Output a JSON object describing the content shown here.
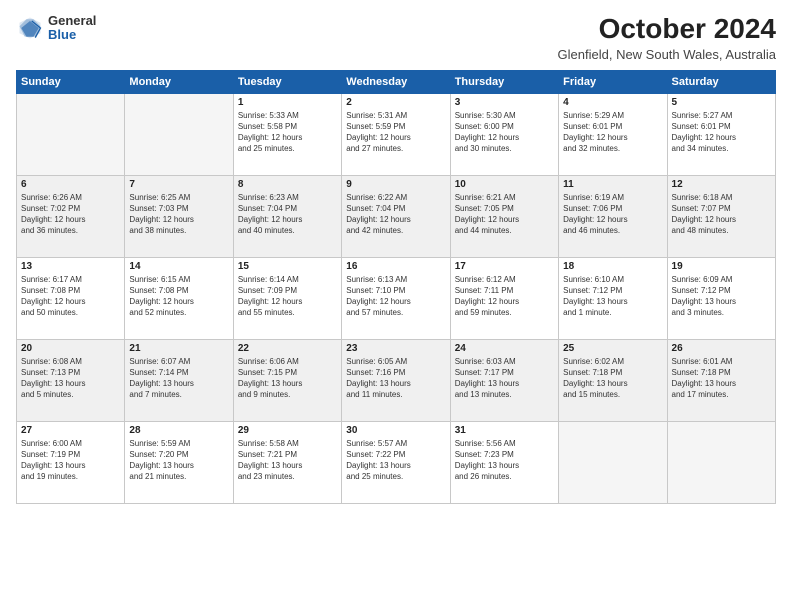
{
  "logo": {
    "general": "General",
    "blue": "Blue"
  },
  "header": {
    "month": "October 2024",
    "location": "Glenfield, New South Wales, Australia"
  },
  "weekdays": [
    "Sunday",
    "Monday",
    "Tuesday",
    "Wednesday",
    "Thursday",
    "Friday",
    "Saturday"
  ],
  "weeks": [
    [
      {
        "day": "",
        "detail": ""
      },
      {
        "day": "",
        "detail": ""
      },
      {
        "day": "1",
        "detail": "Sunrise: 5:33 AM\nSunset: 5:58 PM\nDaylight: 12 hours\nand 25 minutes."
      },
      {
        "day": "2",
        "detail": "Sunrise: 5:31 AM\nSunset: 5:59 PM\nDaylight: 12 hours\nand 27 minutes."
      },
      {
        "day": "3",
        "detail": "Sunrise: 5:30 AM\nSunset: 6:00 PM\nDaylight: 12 hours\nand 30 minutes."
      },
      {
        "day": "4",
        "detail": "Sunrise: 5:29 AM\nSunset: 6:01 PM\nDaylight: 12 hours\nand 32 minutes."
      },
      {
        "day": "5",
        "detail": "Sunrise: 5:27 AM\nSunset: 6:01 PM\nDaylight: 12 hours\nand 34 minutes."
      }
    ],
    [
      {
        "day": "6",
        "detail": "Sunrise: 6:26 AM\nSunset: 7:02 PM\nDaylight: 12 hours\nand 36 minutes."
      },
      {
        "day": "7",
        "detail": "Sunrise: 6:25 AM\nSunset: 7:03 PM\nDaylight: 12 hours\nand 38 minutes."
      },
      {
        "day": "8",
        "detail": "Sunrise: 6:23 AM\nSunset: 7:04 PM\nDaylight: 12 hours\nand 40 minutes."
      },
      {
        "day": "9",
        "detail": "Sunrise: 6:22 AM\nSunset: 7:04 PM\nDaylight: 12 hours\nand 42 minutes."
      },
      {
        "day": "10",
        "detail": "Sunrise: 6:21 AM\nSunset: 7:05 PM\nDaylight: 12 hours\nand 44 minutes."
      },
      {
        "day": "11",
        "detail": "Sunrise: 6:19 AM\nSunset: 7:06 PM\nDaylight: 12 hours\nand 46 minutes."
      },
      {
        "day": "12",
        "detail": "Sunrise: 6:18 AM\nSunset: 7:07 PM\nDaylight: 12 hours\nand 48 minutes."
      }
    ],
    [
      {
        "day": "13",
        "detail": "Sunrise: 6:17 AM\nSunset: 7:08 PM\nDaylight: 12 hours\nand 50 minutes."
      },
      {
        "day": "14",
        "detail": "Sunrise: 6:15 AM\nSunset: 7:08 PM\nDaylight: 12 hours\nand 52 minutes."
      },
      {
        "day": "15",
        "detail": "Sunrise: 6:14 AM\nSunset: 7:09 PM\nDaylight: 12 hours\nand 55 minutes."
      },
      {
        "day": "16",
        "detail": "Sunrise: 6:13 AM\nSunset: 7:10 PM\nDaylight: 12 hours\nand 57 minutes."
      },
      {
        "day": "17",
        "detail": "Sunrise: 6:12 AM\nSunset: 7:11 PM\nDaylight: 12 hours\nand 59 minutes."
      },
      {
        "day": "18",
        "detail": "Sunrise: 6:10 AM\nSunset: 7:12 PM\nDaylight: 13 hours\nand 1 minute."
      },
      {
        "day": "19",
        "detail": "Sunrise: 6:09 AM\nSunset: 7:12 PM\nDaylight: 13 hours\nand 3 minutes."
      }
    ],
    [
      {
        "day": "20",
        "detail": "Sunrise: 6:08 AM\nSunset: 7:13 PM\nDaylight: 13 hours\nand 5 minutes."
      },
      {
        "day": "21",
        "detail": "Sunrise: 6:07 AM\nSunset: 7:14 PM\nDaylight: 13 hours\nand 7 minutes."
      },
      {
        "day": "22",
        "detail": "Sunrise: 6:06 AM\nSunset: 7:15 PM\nDaylight: 13 hours\nand 9 minutes."
      },
      {
        "day": "23",
        "detail": "Sunrise: 6:05 AM\nSunset: 7:16 PM\nDaylight: 13 hours\nand 11 minutes."
      },
      {
        "day": "24",
        "detail": "Sunrise: 6:03 AM\nSunset: 7:17 PM\nDaylight: 13 hours\nand 13 minutes."
      },
      {
        "day": "25",
        "detail": "Sunrise: 6:02 AM\nSunset: 7:18 PM\nDaylight: 13 hours\nand 15 minutes."
      },
      {
        "day": "26",
        "detail": "Sunrise: 6:01 AM\nSunset: 7:18 PM\nDaylight: 13 hours\nand 17 minutes."
      }
    ],
    [
      {
        "day": "27",
        "detail": "Sunrise: 6:00 AM\nSunset: 7:19 PM\nDaylight: 13 hours\nand 19 minutes."
      },
      {
        "day": "28",
        "detail": "Sunrise: 5:59 AM\nSunset: 7:20 PM\nDaylight: 13 hours\nand 21 minutes."
      },
      {
        "day": "29",
        "detail": "Sunrise: 5:58 AM\nSunset: 7:21 PM\nDaylight: 13 hours\nand 23 minutes."
      },
      {
        "day": "30",
        "detail": "Sunrise: 5:57 AM\nSunset: 7:22 PM\nDaylight: 13 hours\nand 25 minutes."
      },
      {
        "day": "31",
        "detail": "Sunrise: 5:56 AM\nSunset: 7:23 PM\nDaylight: 13 hours\nand 26 minutes."
      },
      {
        "day": "",
        "detail": ""
      },
      {
        "day": "",
        "detail": ""
      }
    ]
  ]
}
